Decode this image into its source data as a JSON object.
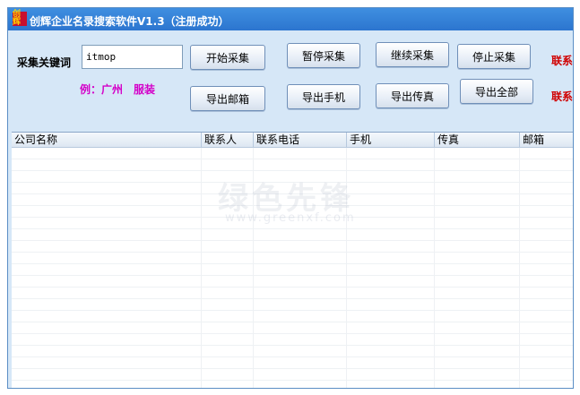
{
  "window": {
    "app_icon_text": "创辉",
    "title": "创辉企业名录搜索软件V1.3（注册成功）"
  },
  "search": {
    "label": "采集关键词",
    "value": "itmop",
    "example_prefix": "例：广州",
    "example_suffix": "服装"
  },
  "buttons": {
    "start": "开始采集",
    "pause": "暂停采集",
    "resume": "继续采集",
    "stop": "停止采集",
    "export_email": "导出邮箱",
    "export_mobile": "导出手机",
    "export_fax": "导出传真",
    "export_all": "导出全部"
  },
  "contact": {
    "line1": "联系",
    "line2": "联系"
  },
  "table": {
    "columns": [
      "公司名称",
      "联系人",
      "联系电话",
      "手机",
      "传真",
      "邮箱"
    ]
  },
  "watermark": {
    "title": "绿色先锋",
    "url": "www.greenxf.com"
  }
}
